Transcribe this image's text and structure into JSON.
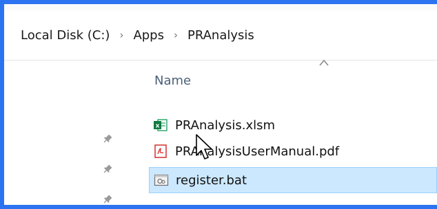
{
  "breadcrumb": {
    "items": [
      "Local Disk (C:)",
      "Apps",
      "PRAnalysis"
    ],
    "separator": "›"
  },
  "column_header": {
    "name": "Name"
  },
  "files": [
    {
      "name": "PRAnalysis.xlsm",
      "icon": "excel-file-icon"
    },
    {
      "name": "PRAnalysisUserManual.pdf",
      "icon": "pdf-file-icon"
    },
    {
      "name": "register.bat",
      "icon": "batch-file-icon",
      "selected": true
    }
  ],
  "colors": {
    "window_border": "#2b73f1",
    "selection_bg": "#cce8ff",
    "selection_border": "#99d1ff",
    "header_text": "#4c607a"
  }
}
